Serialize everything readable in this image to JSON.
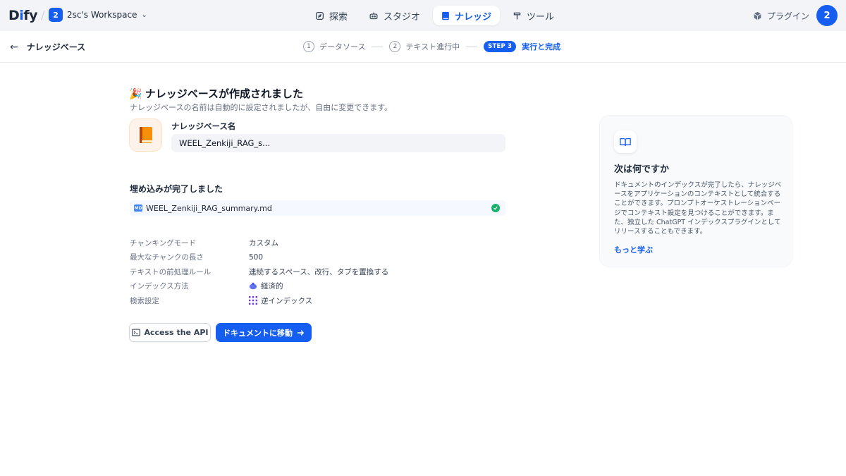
{
  "header": {
    "logo": "Dify",
    "workspace": {
      "badge": "2",
      "name": "2sc's Workspace"
    },
    "tabs": [
      {
        "label": "探索",
        "icon": "compass-icon",
        "active": false
      },
      {
        "label": "スタジオ",
        "icon": "robot-icon",
        "active": false
      },
      {
        "label": "ナレッジ",
        "icon": "book-icon",
        "active": true
      },
      {
        "label": "ツール",
        "icon": "hammer-icon",
        "active": false
      }
    ],
    "plugin_label": "プラグイン",
    "avatar": "2"
  },
  "stepbar": {
    "back_title": "ナレッジベース",
    "steps": [
      {
        "num": "1",
        "label": "データソース"
      },
      {
        "num": "2",
        "label": "テキスト進行中"
      },
      {
        "num": "STEP 3",
        "label": "実行と完成",
        "active": true
      }
    ]
  },
  "main": {
    "title_emoji": "🎉",
    "title": "ナレッジベースが作成されました",
    "subtitle": "ナレッジベースの名前は自動的に設定されましたが、自由に変更できます。",
    "kb_name_label": "ナレッジベース名",
    "kb_name_value": "WEEL_Zenkiji_RAG_s...",
    "embedding_title": "埋め込みが完了しました",
    "file": {
      "badge": "MD",
      "name": "WEEL_Zenkiji_RAG_summary.md",
      "status": "complete"
    },
    "properties": [
      {
        "key": "チャンキングモード",
        "value": "カスタム",
        "icon": ""
      },
      {
        "key": "最大なチャンクの長さ",
        "value": "500",
        "icon": ""
      },
      {
        "key": "テキストの前処理ルール",
        "value": "連続するスペース、改行、タブを置換する",
        "icon": ""
      },
      {
        "key": "インデックス方法",
        "value": "経済的",
        "icon": "piggy-bank-icon"
      },
      {
        "key": "検索設定",
        "value": "逆インデックス",
        "icon": "dot-grid-icon"
      }
    ],
    "api_button": "Access the API",
    "doc_button": "ドキュメントに移動"
  },
  "side": {
    "title": "次は何ですか",
    "body": "ドキュメントのインデックスが完了したら、ナレッジベースをアプリケーションのコンテキストとして統合することができます。プロンプトオーケストレーションページでコンテキスト設定を見つけることができます。また、独立した ChatGPT インデックスプラグインとしてリリースすることもできます。",
    "link": "もっと学ぶ"
  },
  "colors": {
    "accent": "#155eef",
    "success": "#17b26a",
    "nav_bg": "#f2f4f7"
  }
}
